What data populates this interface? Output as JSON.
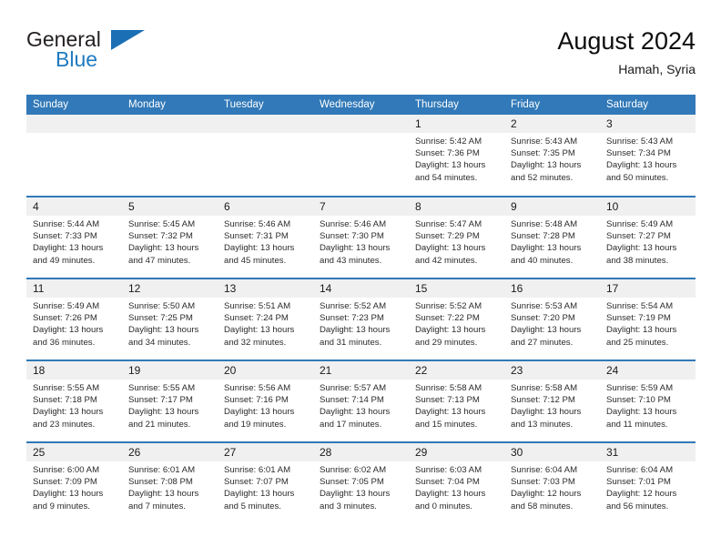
{
  "brand": {
    "name_part1": "General",
    "name_part2": "Blue",
    "accent_color": "#1a6fb5"
  },
  "header": {
    "title": "August 2024",
    "subtitle": "Hamah, Syria"
  },
  "theme": {
    "header_blue": "#3179b8",
    "daynum_band": "#f0f0f0",
    "text": "#1a1a1a"
  },
  "weekdays": [
    "Sunday",
    "Monday",
    "Tuesday",
    "Wednesday",
    "Thursday",
    "Friday",
    "Saturday"
  ],
  "weeks": [
    [
      {
        "day": "",
        "sunrise": "",
        "sunset": "",
        "daylight_line1": "",
        "daylight_line2": "",
        "empty": true
      },
      {
        "day": "",
        "sunrise": "",
        "sunset": "",
        "daylight_line1": "",
        "daylight_line2": "",
        "empty": true
      },
      {
        "day": "",
        "sunrise": "",
        "sunset": "",
        "daylight_line1": "",
        "daylight_line2": "",
        "empty": true
      },
      {
        "day": "",
        "sunrise": "",
        "sunset": "",
        "daylight_line1": "",
        "daylight_line2": "",
        "empty": true
      },
      {
        "day": "1",
        "sunrise": "Sunrise: 5:42 AM",
        "sunset": "Sunset: 7:36 PM",
        "daylight_line1": "Daylight: 13 hours",
        "daylight_line2": "and 54 minutes."
      },
      {
        "day": "2",
        "sunrise": "Sunrise: 5:43 AM",
        "sunset": "Sunset: 7:35 PM",
        "daylight_line1": "Daylight: 13 hours",
        "daylight_line2": "and 52 minutes."
      },
      {
        "day": "3",
        "sunrise": "Sunrise: 5:43 AM",
        "sunset": "Sunset: 7:34 PM",
        "daylight_line1": "Daylight: 13 hours",
        "daylight_line2": "and 50 minutes."
      }
    ],
    [
      {
        "day": "4",
        "sunrise": "Sunrise: 5:44 AM",
        "sunset": "Sunset: 7:33 PM",
        "daylight_line1": "Daylight: 13 hours",
        "daylight_line2": "and 49 minutes."
      },
      {
        "day": "5",
        "sunrise": "Sunrise: 5:45 AM",
        "sunset": "Sunset: 7:32 PM",
        "daylight_line1": "Daylight: 13 hours",
        "daylight_line2": "and 47 minutes."
      },
      {
        "day": "6",
        "sunrise": "Sunrise: 5:46 AM",
        "sunset": "Sunset: 7:31 PM",
        "daylight_line1": "Daylight: 13 hours",
        "daylight_line2": "and 45 minutes."
      },
      {
        "day": "7",
        "sunrise": "Sunrise: 5:46 AM",
        "sunset": "Sunset: 7:30 PM",
        "daylight_line1": "Daylight: 13 hours",
        "daylight_line2": "and 43 minutes."
      },
      {
        "day": "8",
        "sunrise": "Sunrise: 5:47 AM",
        "sunset": "Sunset: 7:29 PM",
        "daylight_line1": "Daylight: 13 hours",
        "daylight_line2": "and 42 minutes."
      },
      {
        "day": "9",
        "sunrise": "Sunrise: 5:48 AM",
        "sunset": "Sunset: 7:28 PM",
        "daylight_line1": "Daylight: 13 hours",
        "daylight_line2": "and 40 minutes."
      },
      {
        "day": "10",
        "sunrise": "Sunrise: 5:49 AM",
        "sunset": "Sunset: 7:27 PM",
        "daylight_line1": "Daylight: 13 hours",
        "daylight_line2": "and 38 minutes."
      }
    ],
    [
      {
        "day": "11",
        "sunrise": "Sunrise: 5:49 AM",
        "sunset": "Sunset: 7:26 PM",
        "daylight_line1": "Daylight: 13 hours",
        "daylight_line2": "and 36 minutes."
      },
      {
        "day": "12",
        "sunrise": "Sunrise: 5:50 AM",
        "sunset": "Sunset: 7:25 PM",
        "daylight_line1": "Daylight: 13 hours",
        "daylight_line2": "and 34 minutes."
      },
      {
        "day": "13",
        "sunrise": "Sunrise: 5:51 AM",
        "sunset": "Sunset: 7:24 PM",
        "daylight_line1": "Daylight: 13 hours",
        "daylight_line2": "and 32 minutes."
      },
      {
        "day": "14",
        "sunrise": "Sunrise: 5:52 AM",
        "sunset": "Sunset: 7:23 PM",
        "daylight_line1": "Daylight: 13 hours",
        "daylight_line2": "and 31 minutes."
      },
      {
        "day": "15",
        "sunrise": "Sunrise: 5:52 AM",
        "sunset": "Sunset: 7:22 PM",
        "daylight_line1": "Daylight: 13 hours",
        "daylight_line2": "and 29 minutes."
      },
      {
        "day": "16",
        "sunrise": "Sunrise: 5:53 AM",
        "sunset": "Sunset: 7:20 PM",
        "daylight_line1": "Daylight: 13 hours",
        "daylight_line2": "and 27 minutes."
      },
      {
        "day": "17",
        "sunrise": "Sunrise: 5:54 AM",
        "sunset": "Sunset: 7:19 PM",
        "daylight_line1": "Daylight: 13 hours",
        "daylight_line2": "and 25 minutes."
      }
    ],
    [
      {
        "day": "18",
        "sunrise": "Sunrise: 5:55 AM",
        "sunset": "Sunset: 7:18 PM",
        "daylight_line1": "Daylight: 13 hours",
        "daylight_line2": "and 23 minutes."
      },
      {
        "day": "19",
        "sunrise": "Sunrise: 5:55 AM",
        "sunset": "Sunset: 7:17 PM",
        "daylight_line1": "Daylight: 13 hours",
        "daylight_line2": "and 21 minutes."
      },
      {
        "day": "20",
        "sunrise": "Sunrise: 5:56 AM",
        "sunset": "Sunset: 7:16 PM",
        "daylight_line1": "Daylight: 13 hours",
        "daylight_line2": "and 19 minutes."
      },
      {
        "day": "21",
        "sunrise": "Sunrise: 5:57 AM",
        "sunset": "Sunset: 7:14 PM",
        "daylight_line1": "Daylight: 13 hours",
        "daylight_line2": "and 17 minutes."
      },
      {
        "day": "22",
        "sunrise": "Sunrise: 5:58 AM",
        "sunset": "Sunset: 7:13 PM",
        "daylight_line1": "Daylight: 13 hours",
        "daylight_line2": "and 15 minutes."
      },
      {
        "day": "23",
        "sunrise": "Sunrise: 5:58 AM",
        "sunset": "Sunset: 7:12 PM",
        "daylight_line1": "Daylight: 13 hours",
        "daylight_line2": "and 13 minutes."
      },
      {
        "day": "24",
        "sunrise": "Sunrise: 5:59 AM",
        "sunset": "Sunset: 7:10 PM",
        "daylight_line1": "Daylight: 13 hours",
        "daylight_line2": "and 11 minutes."
      }
    ],
    [
      {
        "day": "25",
        "sunrise": "Sunrise: 6:00 AM",
        "sunset": "Sunset: 7:09 PM",
        "daylight_line1": "Daylight: 13 hours",
        "daylight_line2": "and 9 minutes."
      },
      {
        "day": "26",
        "sunrise": "Sunrise: 6:01 AM",
        "sunset": "Sunset: 7:08 PM",
        "daylight_line1": "Daylight: 13 hours",
        "daylight_line2": "and 7 minutes."
      },
      {
        "day": "27",
        "sunrise": "Sunrise: 6:01 AM",
        "sunset": "Sunset: 7:07 PM",
        "daylight_line1": "Daylight: 13 hours",
        "daylight_line2": "and 5 minutes."
      },
      {
        "day": "28",
        "sunrise": "Sunrise: 6:02 AM",
        "sunset": "Sunset: 7:05 PM",
        "daylight_line1": "Daylight: 13 hours",
        "daylight_line2": "and 3 minutes."
      },
      {
        "day": "29",
        "sunrise": "Sunrise: 6:03 AM",
        "sunset": "Sunset: 7:04 PM",
        "daylight_line1": "Daylight: 13 hours",
        "daylight_line2": "and 0 minutes."
      },
      {
        "day": "30",
        "sunrise": "Sunrise: 6:04 AM",
        "sunset": "Sunset: 7:03 PM",
        "daylight_line1": "Daylight: 12 hours",
        "daylight_line2": "and 58 minutes."
      },
      {
        "day": "31",
        "sunrise": "Sunrise: 6:04 AM",
        "sunset": "Sunset: 7:01 PM",
        "daylight_line1": "Daylight: 12 hours",
        "daylight_line2": "and 56 minutes."
      }
    ]
  ]
}
